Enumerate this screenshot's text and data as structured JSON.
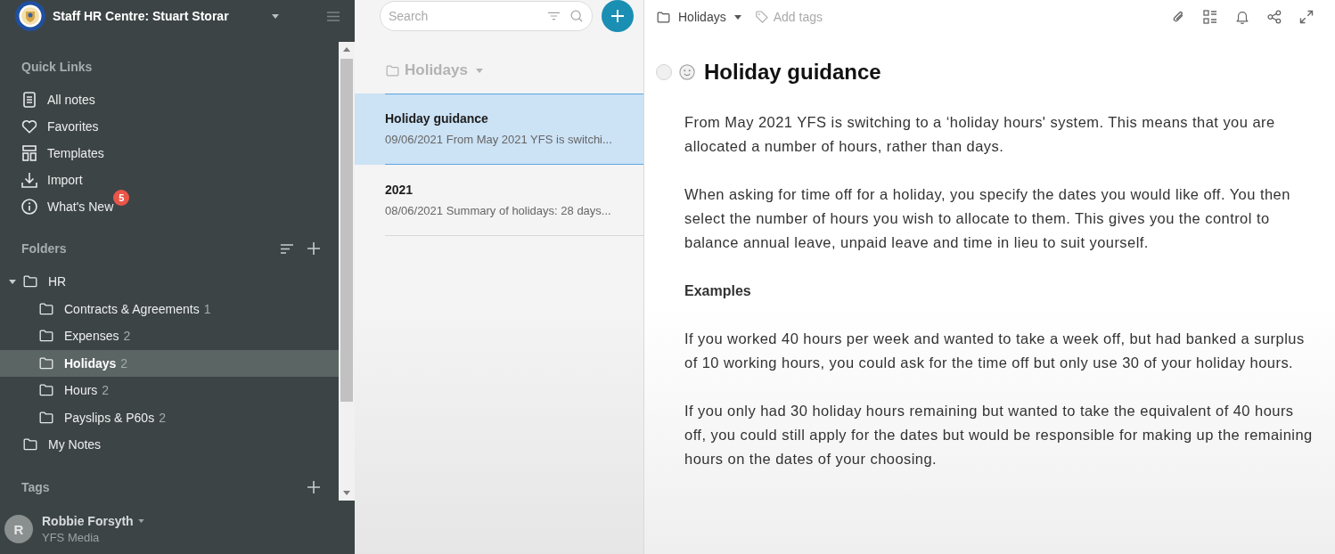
{
  "sidebar": {
    "header": {
      "title": "Staff HR Centre: Stuart Storar"
    },
    "quick_links": {
      "heading": "Quick Links",
      "items": [
        {
          "kind": "notes",
          "label": "All notes",
          "selected": false
        },
        {
          "kind": "favorites",
          "label": "Favorites",
          "selected": false
        },
        {
          "kind": "templates",
          "label": "Templates",
          "selected": false
        },
        {
          "kind": "import",
          "label": "Import",
          "selected": false
        },
        {
          "kind": "info",
          "label": "What's New",
          "badge": "5",
          "selected": false
        }
      ]
    },
    "folders": {
      "heading": "Folders",
      "items": [
        {
          "label": "HR",
          "expanded": true,
          "selected": false,
          "children": [
            {
              "label": "Contracts & Agreements",
              "count": "1",
              "selected": false
            },
            {
              "label": "Expenses",
              "count": "2",
              "selected": false
            },
            {
              "label": "Holidays",
              "count": "2",
              "selected": true
            },
            {
              "label": "Hours",
              "count": "2",
              "selected": false
            },
            {
              "label": "Payslips & P60s",
              "count": "2",
              "selected": false
            }
          ]
        },
        {
          "label": "My Notes",
          "selected": false
        }
      ]
    },
    "tags": {
      "heading": "Tags"
    },
    "user": {
      "initial": "R",
      "name": "Robbie Forsyth",
      "organization": "YFS Media"
    }
  },
  "note_list": {
    "search": {
      "placeholder": "Search"
    },
    "folder": "Holidays",
    "notes": [
      {
        "title": "Holiday guidance",
        "date": "09/06/2021",
        "preview": "From May 2021 YFS is switchi...",
        "selected": true
      },
      {
        "title": "2021",
        "date": "08/06/2021",
        "preview": "Summary of holidays: 28 days...",
        "selected": false
      }
    ]
  },
  "editor": {
    "toolbar": {
      "folder": "Holidays",
      "tags_placeholder": "Add tags"
    },
    "checked": false,
    "title": "Holiday guidance",
    "body": [
      {
        "kind": "text",
        "text": "From May 2021 YFS is switching to a ‘holiday hours' system. This means that you are allocated a number of hours, rather than days."
      },
      {
        "kind": "text",
        "text": "When asking for time off for a holiday, you specify the dates you would like off. You then select the number of hours you wish to allocate to them. This gives you the control to balance annual leave, unpaid leave and time in lieu to suit yourself."
      },
      {
        "kind": "heading",
        "text": "Examples"
      },
      {
        "kind": "text",
        "text": "If you worked 40 hours per week and wanted to take a week off, but had banked a surplus of 10 working hours, you could ask for the time off but only use 30 of your holiday hours."
      },
      {
        "kind": "text",
        "text": "If you only had 30 holiday hours remaining but wanted to take the equivalent of 40 hours off, you could still apply for the dates but would be responsible for making up the remaining hours on the dates of your choosing."
      }
    ]
  }
}
